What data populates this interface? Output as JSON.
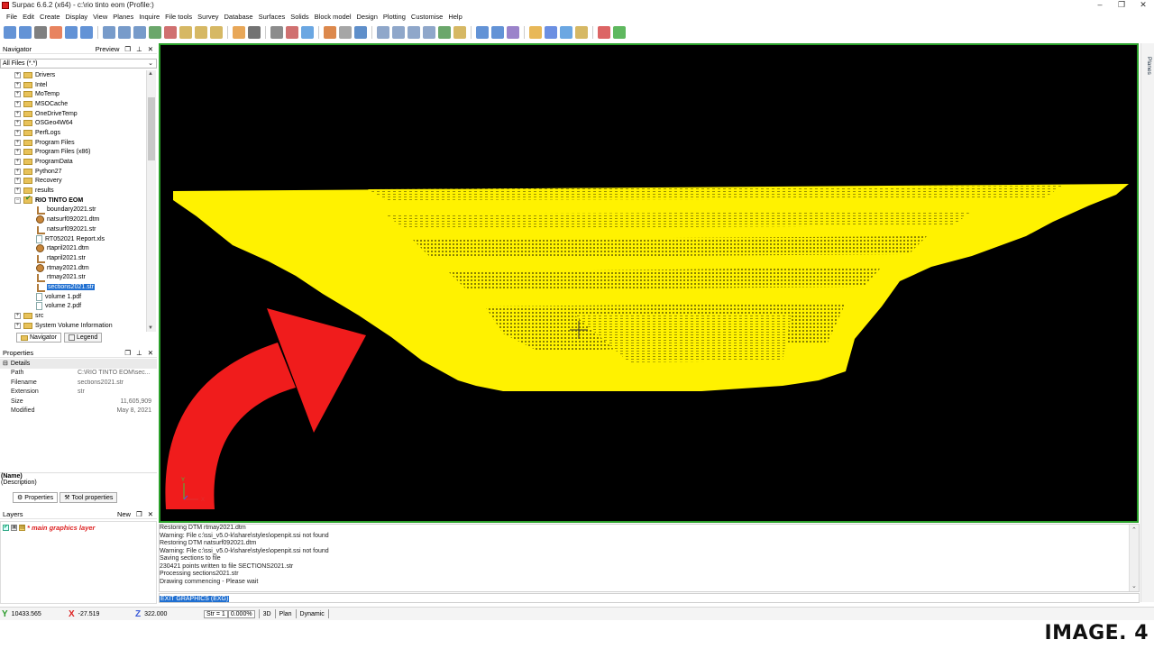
{
  "window": {
    "title": "Surpac 6.6.2 (x64) - c:\\rio tinto eom (Profile:)",
    "controls": [
      "–",
      "❐",
      "✕"
    ]
  },
  "menu": [
    "File",
    "Edit",
    "Create",
    "Display",
    "View",
    "Planes",
    "Inquire",
    "File tools",
    "Survey",
    "Database",
    "Surfaces",
    "Solids",
    "Block model",
    "Design",
    "Plotting",
    "Customise",
    "Help"
  ],
  "navigator": {
    "title": "Navigator",
    "preview_label": "Preview",
    "filter": "All Files (*.*)",
    "items": [
      {
        "label": "Drivers",
        "type": "folder",
        "exp": "+"
      },
      {
        "label": "Intel",
        "type": "folder",
        "exp": "+"
      },
      {
        "label": "MoTemp",
        "type": "folder",
        "exp": "+"
      },
      {
        "label": "MSOCache",
        "type": "folder",
        "exp": "+"
      },
      {
        "label": "OneDriveTemp",
        "type": "folder",
        "exp": "+"
      },
      {
        "label": "OSGeo4W64",
        "type": "folder",
        "exp": "+"
      },
      {
        "label": "PerfLogs",
        "type": "folder",
        "exp": "+"
      },
      {
        "label": "Program Files",
        "type": "folder",
        "exp": "+"
      },
      {
        "label": "Program Files (x86)",
        "type": "folder",
        "exp": "+"
      },
      {
        "label": "ProgramData",
        "type": "folder",
        "exp": "+"
      },
      {
        "label": "Python27",
        "type": "folder",
        "exp": "+"
      },
      {
        "label": "Recovery",
        "type": "folder",
        "exp": "+"
      },
      {
        "label": "results",
        "type": "folder",
        "exp": "+"
      },
      {
        "label": "RIO TINTO EOM",
        "type": "rio",
        "exp": "−"
      },
      {
        "label": "boundary2021.str",
        "type": "str",
        "child": true
      },
      {
        "label": "natsurf092021.dtm",
        "type": "dtm",
        "child": true
      },
      {
        "label": "natsurf092021.str",
        "type": "str",
        "child": true
      },
      {
        "label": "RT052021 Report.xls",
        "type": "file",
        "child": true
      },
      {
        "label": "rtapril2021.dtm",
        "type": "dtm",
        "child": true
      },
      {
        "label": "rtapril2021.str",
        "type": "str",
        "child": true
      },
      {
        "label": "rtmay2021.dtm",
        "type": "dtm",
        "child": true
      },
      {
        "label": "rtmay2021.str",
        "type": "str",
        "child": true
      },
      {
        "label": "sections2021.str",
        "type": "str",
        "child": true,
        "selected": true
      },
      {
        "label": "volume 1.pdf",
        "type": "file",
        "child": true
      },
      {
        "label": "volume 2.pdf",
        "type": "file",
        "child": true
      },
      {
        "label": "src",
        "type": "folder",
        "exp": "+"
      },
      {
        "label": "System Volume Information",
        "type": "folder",
        "exp": "+"
      }
    ],
    "tabs": {
      "navigator": "Navigator",
      "legend": "Legend"
    }
  },
  "properties": {
    "title": "Properties",
    "section": "Details",
    "rows": [
      {
        "k": "Path",
        "v": "C:\\RIO TINTO EOM\\sec..."
      },
      {
        "k": "Filename",
        "v": "sections2021.str"
      },
      {
        "k": "Extension",
        "v": "str"
      },
      {
        "k": "Size",
        "v": "11,605,909"
      },
      {
        "k": "Modified",
        "v": "May 8, 2021"
      }
    ],
    "name": "(Name)",
    "description": "(Description)",
    "tabs": {
      "properties": "Properties",
      "tool": "Tool properties"
    }
  },
  "layers": {
    "title": "Layers",
    "new_label": "New",
    "items": [
      {
        "name": "* main graphics layer"
      }
    ]
  },
  "viewport": {
    "axis_y": "Y",
    "axis_x": "X",
    "colors": {
      "background": "#000000",
      "surface": "#fff200",
      "border": "#2aa02a"
    }
  },
  "planes_tab": "Planes",
  "log": {
    "lines": [
      "Restoring DTM rtmay2021.dtm",
      "Warning: File c:\\ssi_v5.0-k\\share\\styles\\openpit.ssi not found",
      "Restoring DTM natsurf092021.dtm",
      "Warning: File c:\\ssi_v5.0-k\\share\\styles\\openpit.ssi not found",
      "Saving sections to file",
      "230421 points written to file SECTIONS2021.str",
      "Processing sections2021.str",
      "Drawing commencing - Please wait"
    ],
    "command": "EXIT GRAPHICS (EXG)"
  },
  "status": {
    "y": "10433.565",
    "x": "-27.519",
    "z": "322.000",
    "str": "Str = 1",
    "pct": "0.000%",
    "mode3d": "3D",
    "plan": "Plan",
    "dynamic": "Dynamic"
  },
  "caption": "IMAGE. 4"
}
